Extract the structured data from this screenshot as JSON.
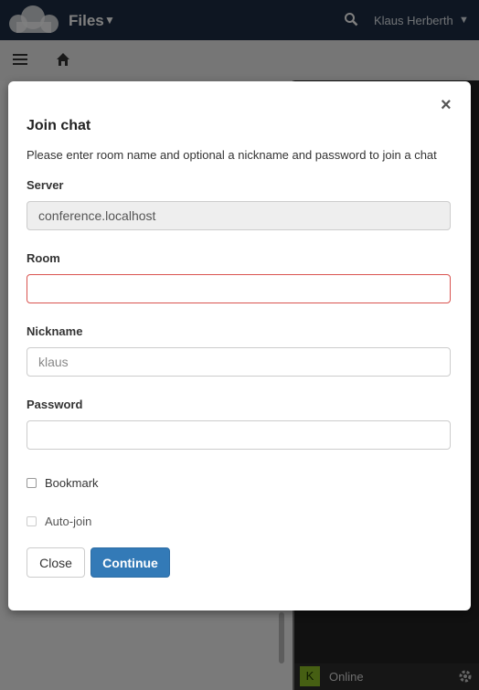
{
  "header": {
    "app_title": "Files",
    "user_name": "Klaus Herberth"
  },
  "chat_status": {
    "avatar_letter": "K",
    "status": "Online"
  },
  "dialog": {
    "title": "Join chat",
    "description": "Please enter room name and optional a nickname and password to join a chat",
    "server_label": "Server",
    "server_value": "conference.localhost",
    "room_label": "Room",
    "room_value": "",
    "nickname_label": "Nickname",
    "nickname_placeholder": "klaus",
    "password_label": "Password",
    "password_value": "",
    "bookmark_label": "Bookmark",
    "autojoin_label": "Auto-join",
    "close_button": "Close",
    "continue_button": "Continue"
  },
  "colors": {
    "header_bg": "#1d2d44",
    "primary_button": "#337ab7",
    "error_border": "#d9534f",
    "online_avatar": "#8cbf26"
  },
  "icons": {
    "logo": "owncloud-logo-icon",
    "search": "search-icon",
    "menu": "menu-icon",
    "home": "home-icon",
    "settings": "gear-icon",
    "close": "close-icon"
  }
}
